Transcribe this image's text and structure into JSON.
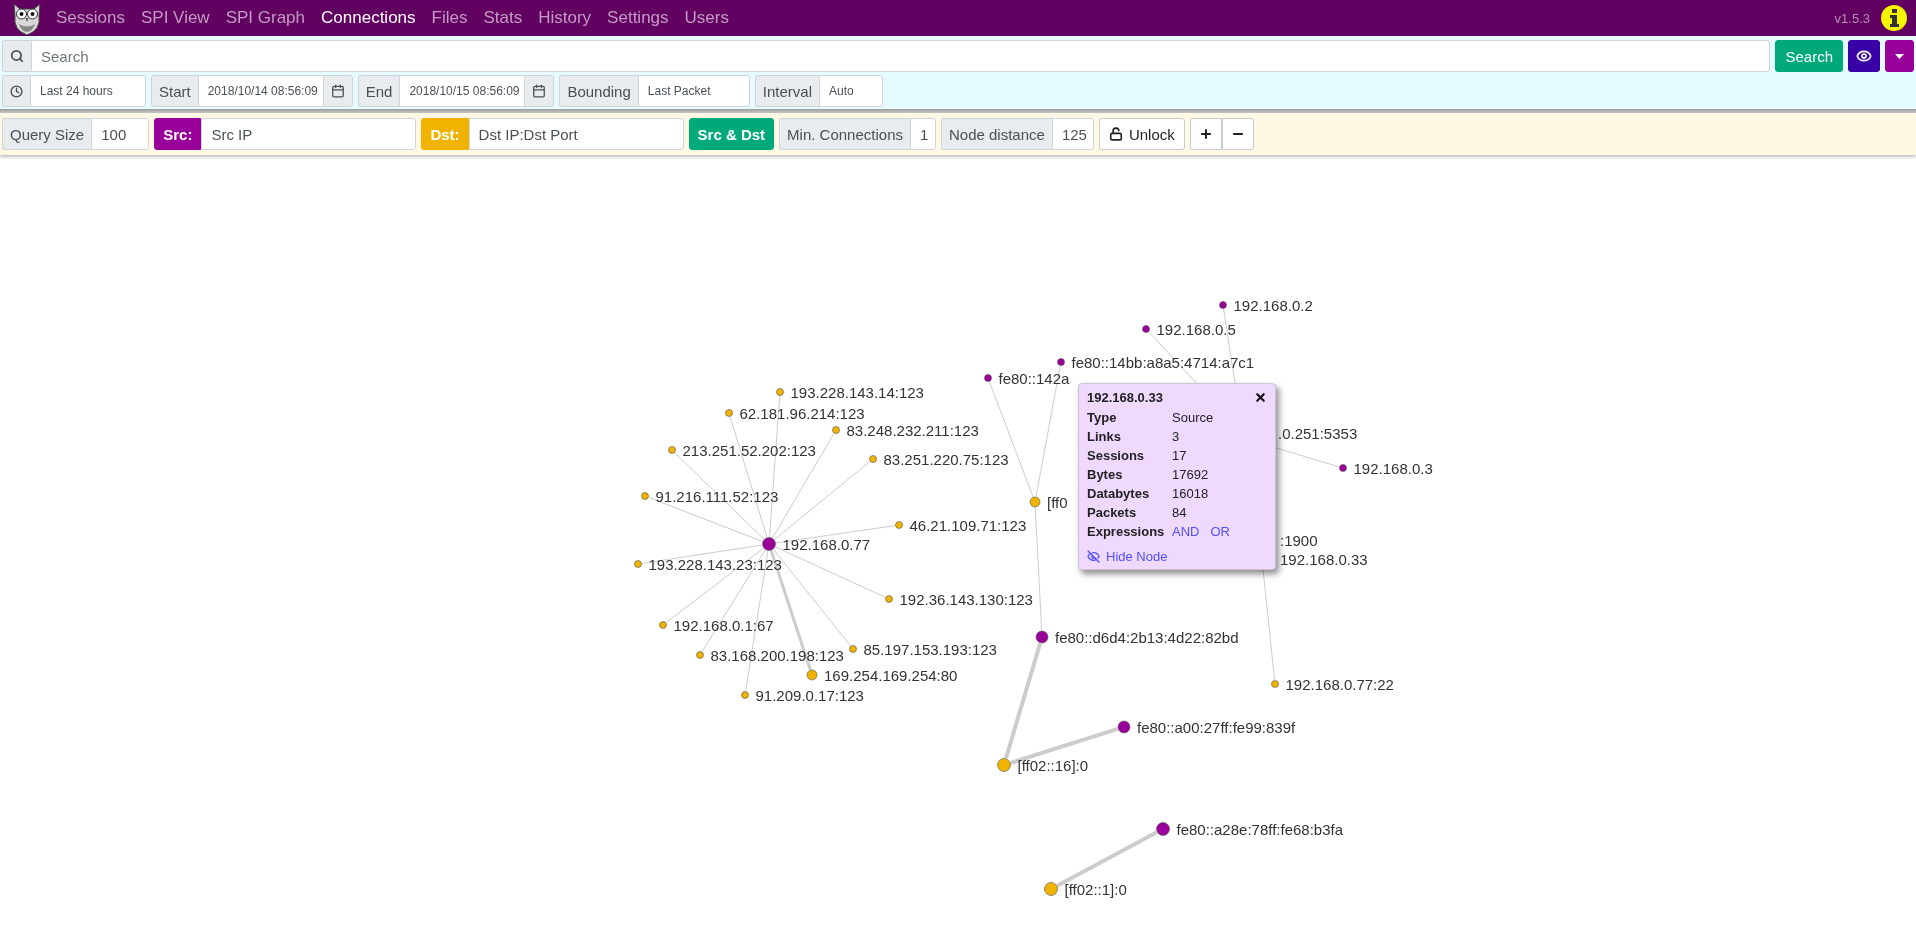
{
  "nav": {
    "items": [
      {
        "label": "Sessions",
        "selected": false
      },
      {
        "label": "SPI View",
        "selected": false
      },
      {
        "label": "SPI Graph",
        "selected": false
      },
      {
        "label": "Connections",
        "selected": true
      },
      {
        "label": "Files",
        "selected": false
      },
      {
        "label": "Stats",
        "selected": false
      },
      {
        "label": "History",
        "selected": false
      },
      {
        "label": "Settings",
        "selected": false
      },
      {
        "label": "Users",
        "selected": false
      }
    ],
    "version": "v1.5.3"
  },
  "search": {
    "placeholder": "Search",
    "button": "Search"
  },
  "time": {
    "range": "Last 24 hours",
    "start_label": "Start",
    "start": "2018/10/14 08:56:09",
    "end_label": "End",
    "end": "2018/10/15 08:56:09",
    "bounding_label": "Bounding",
    "bounding": "Last Packet",
    "interval_label": "Interval",
    "interval": "Auto"
  },
  "toolbar": {
    "query_size_label": "Query Size",
    "query_size": "100",
    "src_label": "Src:",
    "src": "Src IP",
    "dst_label": "Dst:",
    "dst": "Dst IP:Dst Port",
    "both_button": "Src & Dst",
    "min_connections_label": "Min. Connections",
    "min_connections": "1",
    "node_distance_label": "Node distance",
    "node_distance": "125",
    "lock_button": "Unlock"
  },
  "graph": {
    "nodes": [
      {
        "label": "192.168.0.2",
        "kind": "source"
      },
      {
        "label": "192.168.0.5",
        "kind": "source"
      },
      {
        "label": "fe80::14bb:a8a5:4714:a7c1",
        "kind": "source"
      },
      {
        "label": "fe80::142a",
        "kind": "source"
      },
      {
        "label": "193.228.143.14:123",
        "kind": "destination"
      },
      {
        "label": "62.181.96.214:123",
        "kind": "destination"
      },
      {
        "label": "83.248.232.211:123",
        "kind": "destination"
      },
      {
        "label": ".0.251:5353",
        "kind": "hidden"
      },
      {
        "label": "213.251.52.202:123",
        "kind": "destination"
      },
      {
        "label": "83.251.220.75:123",
        "kind": "destination"
      },
      {
        "label": "192.168.0.3",
        "kind": "source"
      },
      {
        "label": "91.216.111.52:123",
        "kind": "destination"
      },
      {
        "label": "[ff0",
        "kind": "destination"
      },
      {
        "label": "46.21.109.71:123",
        "kind": "destination"
      },
      {
        "label": ":1900",
        "kind": "hidden"
      },
      {
        "label": "192.168.0.77",
        "kind": "source"
      },
      {
        "label": "192.168.0.33",
        "kind": "hidden"
      },
      {
        "label": "193.228.143.23:123",
        "kind": "destination"
      },
      {
        "label": "192.36.143.130:123",
        "kind": "destination"
      },
      {
        "label": "192.168.0.1:67",
        "kind": "destination"
      },
      {
        "label": "fe80::d6d4:2b13:4d22:82bd",
        "kind": "source"
      },
      {
        "label": "85.197.153.193:123",
        "kind": "destination"
      },
      {
        "label": "83.168.200.198:123",
        "kind": "destination"
      },
      {
        "label": "169.254.169.254:80",
        "kind": "destination"
      },
      {
        "label": "192.168.0.77:22",
        "kind": "destination"
      },
      {
        "label": "91.209.0.17:123",
        "kind": "destination"
      },
      {
        "label": "fe80::a00:27ff:fe99:839f",
        "kind": "source"
      },
      {
        "label": "[ff02::16]:0",
        "kind": "destination"
      },
      {
        "label": "fe80::a28e:78ff:fe68:b3fa",
        "kind": "source"
      },
      {
        "label": "[ff02::1]:0",
        "kind": "destination"
      }
    ],
    "popup": {
      "title": "192.168.0.33",
      "rows": [
        {
          "label": "Type",
          "value": "Source"
        },
        {
          "label": "Links",
          "value": "3"
        },
        {
          "label": "Sessions",
          "value": "17"
        },
        {
          "label": "Bytes",
          "value": "17692"
        },
        {
          "label": "Databytes",
          "value": "16018"
        },
        {
          "label": "Packets",
          "value": "84"
        }
      ],
      "expressions_label": "Expressions",
      "expressions": [
        "AND",
        "OR"
      ],
      "hide": "Hide Node"
    }
  }
}
